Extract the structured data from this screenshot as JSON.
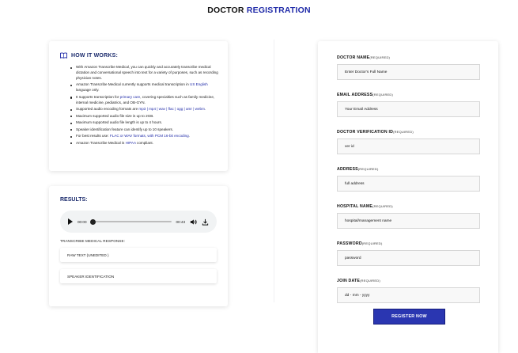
{
  "header": {
    "title_prefix": "DOCTOR ",
    "title_accent": "REGISTRATION"
  },
  "how_it_works": {
    "title": "HOW IT WORKS:",
    "items": [
      {
        "pre": "With Amazon Transcribe Medical, you can quickly and accurately transcribe medical dictation and conversational speech into text for a variety of purposes, such as recording physician notes.",
        "hl": "",
        "post": ""
      },
      {
        "pre": "Amazon Transcribe Medical currently supports medical transcription in ",
        "hl": "US English",
        "post": " language only."
      },
      {
        "pre": "It supports transcription for ",
        "hl": "primary care",
        "post": ", covering specialties such as family medicine, internal medicine, pediatrics, and OB-GYN."
      },
      {
        "pre": "Supported audio encoding formats are ",
        "hl": "mp3 | mp4 | wav | flac | ogg | amr | webm",
        "post": "."
      },
      {
        "pre": "Maximum supported audio file size is up to 2GB.",
        "hl": "",
        "post": ""
      },
      {
        "pre": "Maximum supported audio file length is up to 4 hours.",
        "hl": "",
        "post": ""
      },
      {
        "pre": "Speaker identification feature can identify up to 10 speakers.",
        "hl": "",
        "post": ""
      },
      {
        "pre": "For best results use: ",
        "hl": "FLAC or WAV formats, with PCM 16-bit encoding",
        "post": "."
      },
      {
        "pre": "Amazon Transcribe Medical is ",
        "hl": "HIPAA",
        "post": " compliant."
      }
    ]
  },
  "results": {
    "title": "RESULTS:",
    "player": {
      "current_time": "00:00",
      "duration": "00:43",
      "progress": 0
    },
    "response_label": "TRANSCRIBE MEDICAL RESPONSE:",
    "raw_text": "RAW TEXT (UNEDITED )",
    "speaker_id": "SPEAKER IDENTIFICATION"
  },
  "form": {
    "fields": [
      {
        "label": "DOCTOR NAME",
        "req": "(REQUIRED)",
        "placeholder": "Enter Doctor's Full Name"
      },
      {
        "label": "EMAIL ADDRESS",
        "req": "(REQUIRED)",
        "placeholder": "Your Email Address"
      },
      {
        "label": "DOCTOR VERIFICATION ID",
        "req": "(REQUIRED)",
        "placeholder": "ver id"
      },
      {
        "label": "ADDRESS",
        "req": "(REQUIRED)",
        "placeholder": "full address"
      },
      {
        "label": "HOSPITAL NAME",
        "req": "(REQUIRED)",
        "placeholder": "hospital/management name"
      },
      {
        "label": "PASSWORD",
        "req": "(REQUIRED)",
        "placeholder": "password"
      },
      {
        "label": "JOIN DATE",
        "req": "(REQUIRED)",
        "placeholder": "dd - mm - yyyy"
      }
    ],
    "submit_label": "REGISTER NOW"
  },
  "colors": {
    "accent": "#1f2aa8",
    "button": "#2a36b1",
    "heading": "#1a2a6c"
  },
  "icons": {
    "how_icon": "book-icon",
    "play": "play-icon",
    "volume": "volume-icon",
    "download": "download-icon"
  }
}
